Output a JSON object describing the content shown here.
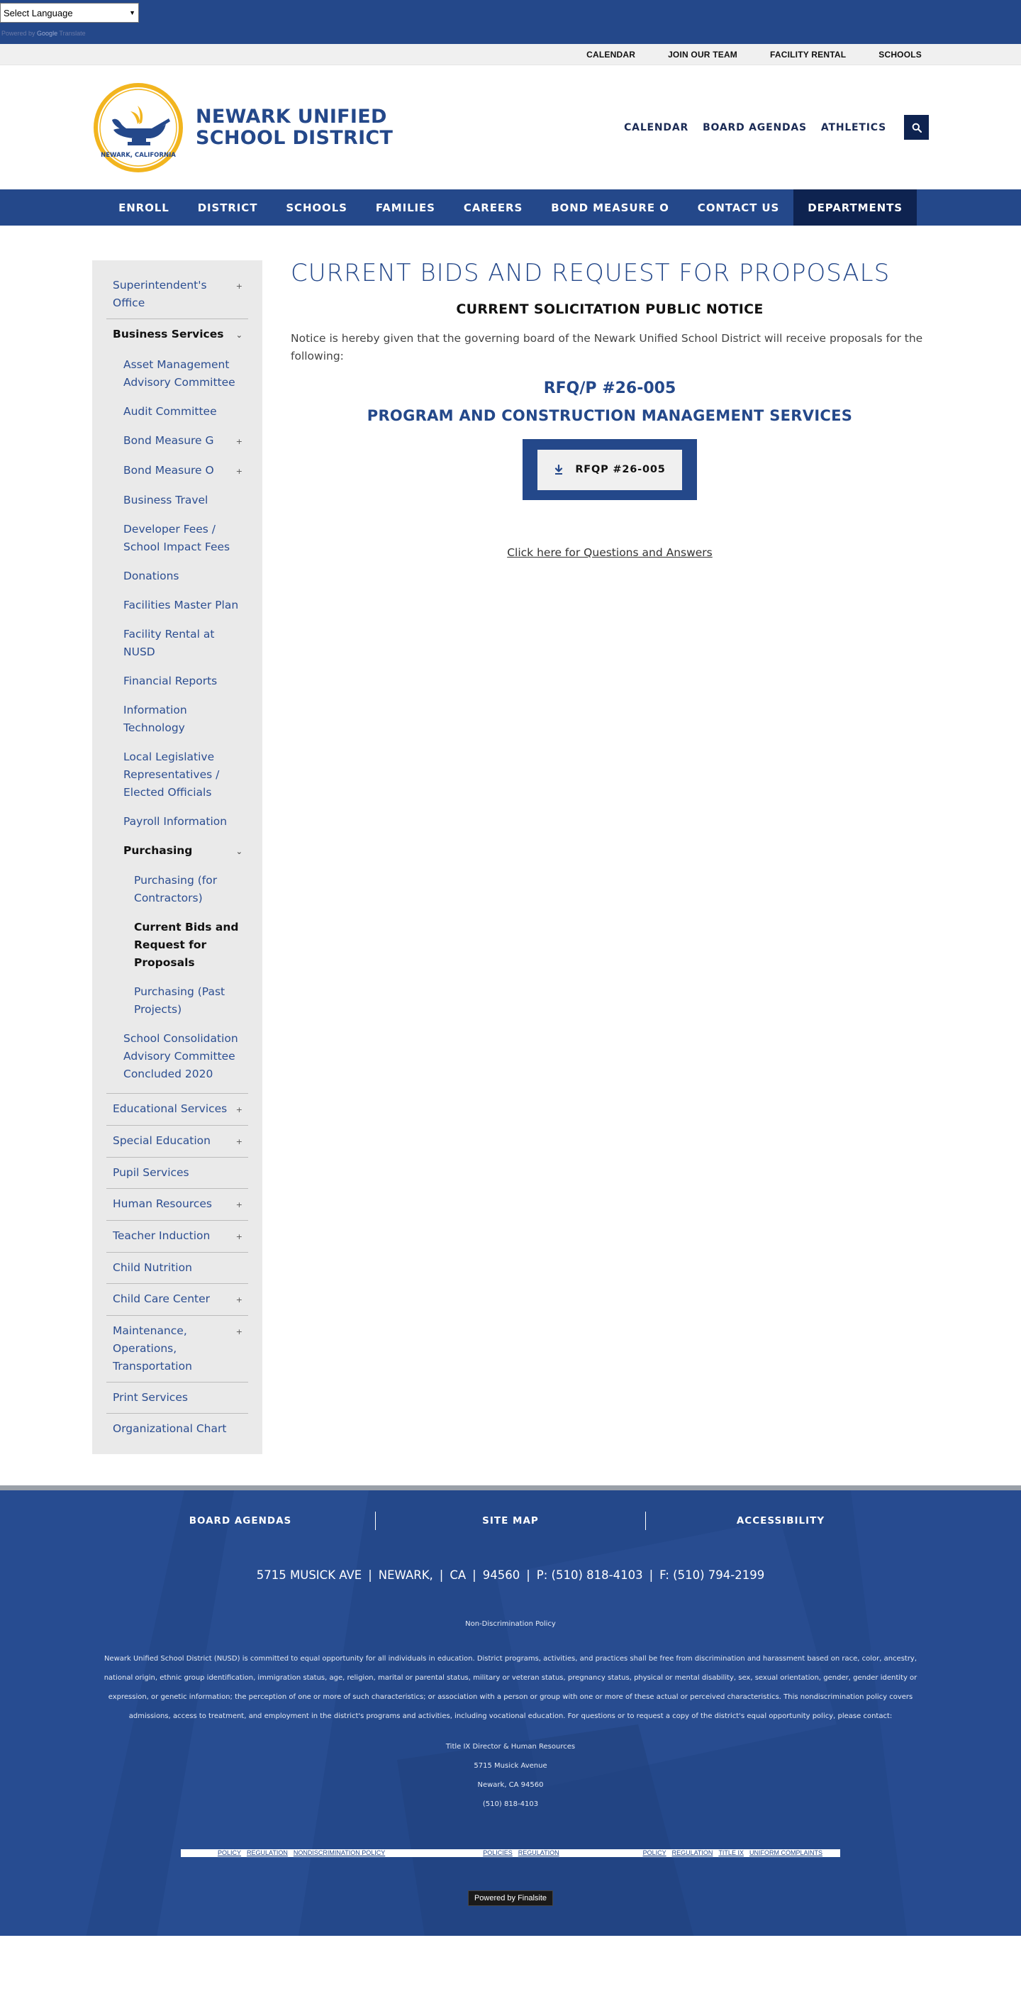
{
  "translate": {
    "select_label": "Select Language",
    "powered_by": "Powered by",
    "google": "Google",
    "translate_word": "Translate"
  },
  "utility_nav": [
    "CALENDAR",
    "JOIN OUR TEAM",
    "FACILITY RENTAL",
    "SCHOOLS"
  ],
  "brand": {
    "line1": "NEWARK UNIFIED",
    "line2": "SCHOOL DISTRICT",
    "seal_text": "NEWARK, CALIFORNIA"
  },
  "header_nav": [
    "CALENDAR",
    "BOARD AGENDAS",
    "ATHLETICS"
  ],
  "main_nav": [
    "ENROLL",
    "DISTRICT",
    "SCHOOLS",
    "FAMILIES",
    "CAREERS",
    "BOND MEASURE O",
    "CONTACT US",
    "DEPARTMENTS"
  ],
  "sidebar": {
    "superintendent": "Superintendent's Office",
    "business": "Business Services",
    "business_children": [
      {
        "label": "Asset Management Advisory Committee",
        "toggle": ""
      },
      {
        "label": "Audit Committee",
        "toggle": ""
      },
      {
        "label": "Bond Measure G",
        "toggle": "+"
      },
      {
        "label": "Bond Measure O",
        "toggle": "+"
      },
      {
        "label": "Business Travel",
        "toggle": ""
      },
      {
        "label": "Developer Fees / School Impact Fees",
        "toggle": ""
      },
      {
        "label": "Donations",
        "toggle": ""
      },
      {
        "label": "Facilities Master Plan",
        "toggle": ""
      },
      {
        "label": "Facility Rental at NUSD",
        "toggle": ""
      },
      {
        "label": "Financial Reports",
        "toggle": ""
      },
      {
        "label": "Information Technology",
        "toggle": ""
      },
      {
        "label": "Local Legislative Representatives / Elected Officials",
        "toggle": ""
      },
      {
        "label": "Payroll Information",
        "toggle": ""
      }
    ],
    "purchasing": "Purchasing",
    "purchasing_children": [
      "Purchasing (for Contractors)",
      "Current Bids and Request for Proposals",
      "Purchasing (Past Projects)"
    ],
    "school_consolidation": "School Consolidation Advisory Committee Concluded 2020",
    "rest": [
      {
        "label": "Educational Services",
        "toggle": "+"
      },
      {
        "label": "Special Education",
        "toggle": "+"
      },
      {
        "label": "Pupil Services",
        "toggle": ""
      },
      {
        "label": "Human Resources",
        "toggle": "+"
      },
      {
        "label": "Teacher Induction",
        "toggle": "+"
      },
      {
        "label": "Child Nutrition",
        "toggle": ""
      },
      {
        "label": "Child Care Center",
        "toggle": "+"
      },
      {
        "label": "Maintenance, Operations, Transportation",
        "toggle": "+"
      },
      {
        "label": "Print Services",
        "toggle": ""
      },
      {
        "label": "Organizational Chart",
        "toggle": ""
      }
    ],
    "plus": "+",
    "chevron": "⌄"
  },
  "main": {
    "title": "CURRENT BIDS AND REQUEST FOR PROPOSALS",
    "subtitle": "CURRENT SOLICITATION PUBLIC NOTICE",
    "notice": "Notice is hereby given that the governing board of the Newark Unified School District will receive proposals for the following:",
    "rfq": "RFQ/P #26-005",
    "program": "PROGRAM AND CONSTRUCTION MANAGEMENT SERVICES",
    "download_label": "RFQP #26-005",
    "qa_link": "Click here for Questions and Answers"
  },
  "footer": {
    "links": [
      "BOARD AGENDAS",
      "SITE MAP",
      "ACCESSIBILITY"
    ],
    "address": {
      "street": "5715 MUSICK AVE",
      "city": "NEWARK,",
      "state": "CA",
      "zip": "94560",
      "phone": "P: (510) 818-4103",
      "fax": "F: (510) 794-2199"
    },
    "nd_policy": "Non-Discrimination Policy",
    "policy_text": "Newark Unified School District (NUSD) is committed to equal opportunity for all individuals in education. District programs, activities, and practices shall be free from discrimination and harassment based on race, color, ancestry, national origin, ethnic group identification, immigration status, age, religion, marital or parental status, military or veteran status, pregnancy status, physical or mental disability, sex, sexual orientation, gender, gender identity or expression, or genetic information; the perception of one or more of such characteristics; or association with a person or group with one or more of these actual or perceived characteristics. This nondiscrimination policy covers admissions, access to treatment, and employment in the district's programs and activities, including vocational education. For questions or to request a copy of the district's equal opportunity policy, please contact:",
    "contact": [
      "Title IX Director & Human Resources",
      "5715 Musick Avenue",
      "Newark, CA 94560",
      "(510) 818-4103"
    ],
    "strip_links": [
      "POLICY",
      "REGULATION",
      "NONDISCRIMINATION POLICY",
      "POLICIES",
      "REGULATION",
      "POLICY",
      "REGULATION",
      "TITLE IX",
      "UNIFORM COMPLAINTS"
    ],
    "badge": "Powered by Finalsite"
  },
  "colors": {
    "brand_blue": "#24488a",
    "navy": "#0e2350",
    "seal_gold": "#f2b51f"
  }
}
